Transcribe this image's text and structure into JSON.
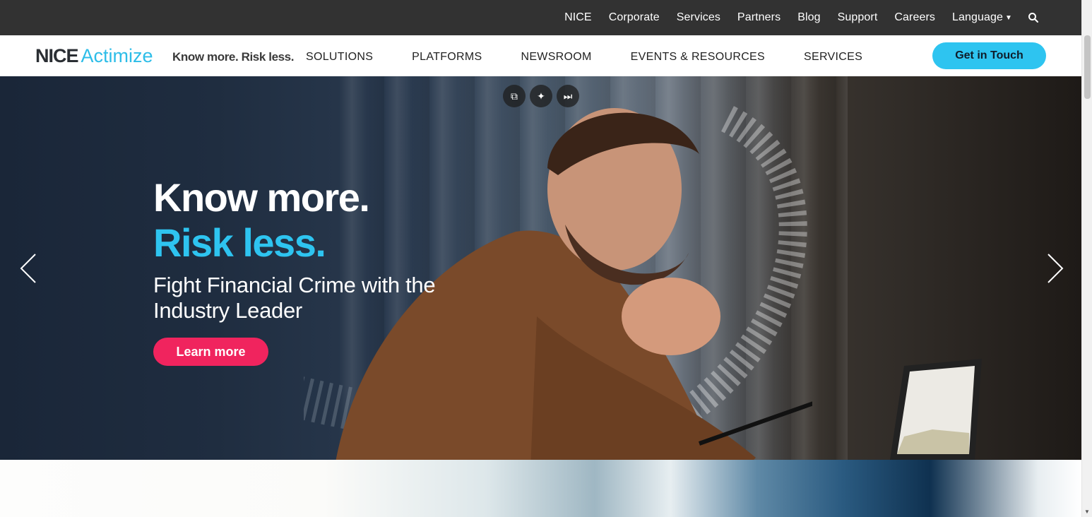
{
  "utility_nav": [
    "NICE",
    "Corporate",
    "Services",
    "Partners",
    "Blog",
    "Support",
    "Careers",
    "Language"
  ],
  "brand": {
    "logo_part1": "NICE",
    "logo_part2": "Actimize",
    "tagline": "Know more. Risk less."
  },
  "main_nav": [
    "SOLUTIONS",
    "PLATFORMS",
    "NEWSROOM",
    "EVENTS & RESOURCES",
    "SERVICES"
  ],
  "cta_label": "Get in Touch",
  "hero": {
    "headline_1": "Know more.",
    "headline_2": "Risk less.",
    "subheading": "Fight Financial Crime with the Industry Leader",
    "button_label": "Learn more"
  },
  "colors": {
    "accent_blue": "#2ec4f0",
    "cta_pink": "#f0245e",
    "top_bar": "#323232"
  },
  "icons": {
    "search": "search-icon",
    "language_caret": "caret-down-icon",
    "pip": "picture-in-picture-icon",
    "sparkle": "sparkle-icon",
    "skip": "skip-forward-icon",
    "prev": "chevron-left-icon",
    "next": "chevron-right-icon"
  }
}
